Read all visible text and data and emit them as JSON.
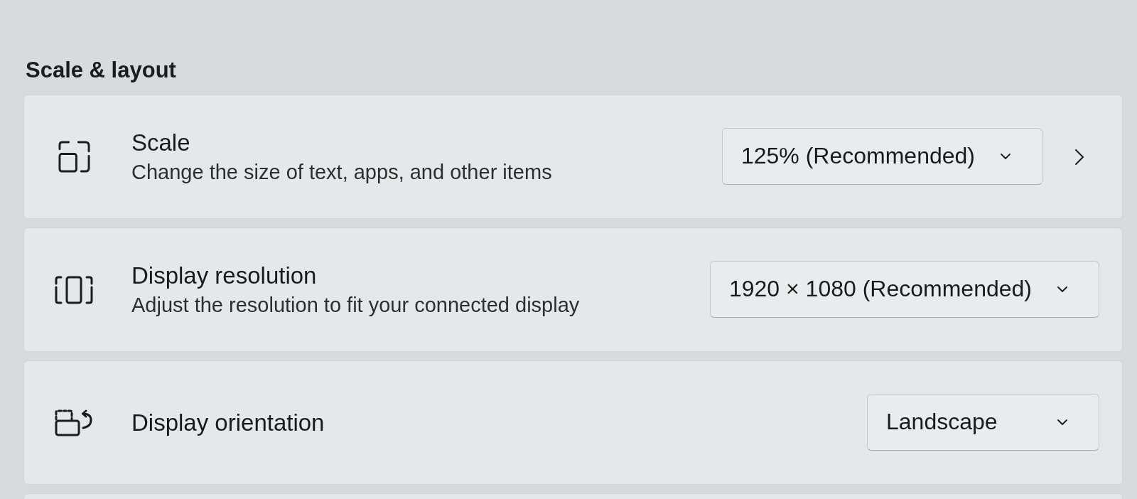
{
  "section": {
    "title": "Scale & layout"
  },
  "settings": [
    {
      "kind": "scale",
      "title": "Scale",
      "description": "Change the size of text, apps, and other items",
      "dropdown": {
        "value": "125% (Recommended)"
      },
      "navigates": true
    },
    {
      "kind": "resolution",
      "title": "Display resolution",
      "description": "Adjust the resolution to fit your connected display",
      "dropdown": {
        "value": "1920 × 1080 (Recommended)"
      },
      "navigates": false
    },
    {
      "kind": "orientation",
      "title": "Display orientation",
      "dropdown": {
        "value": "Landscape"
      },
      "navigates": false
    }
  ]
}
